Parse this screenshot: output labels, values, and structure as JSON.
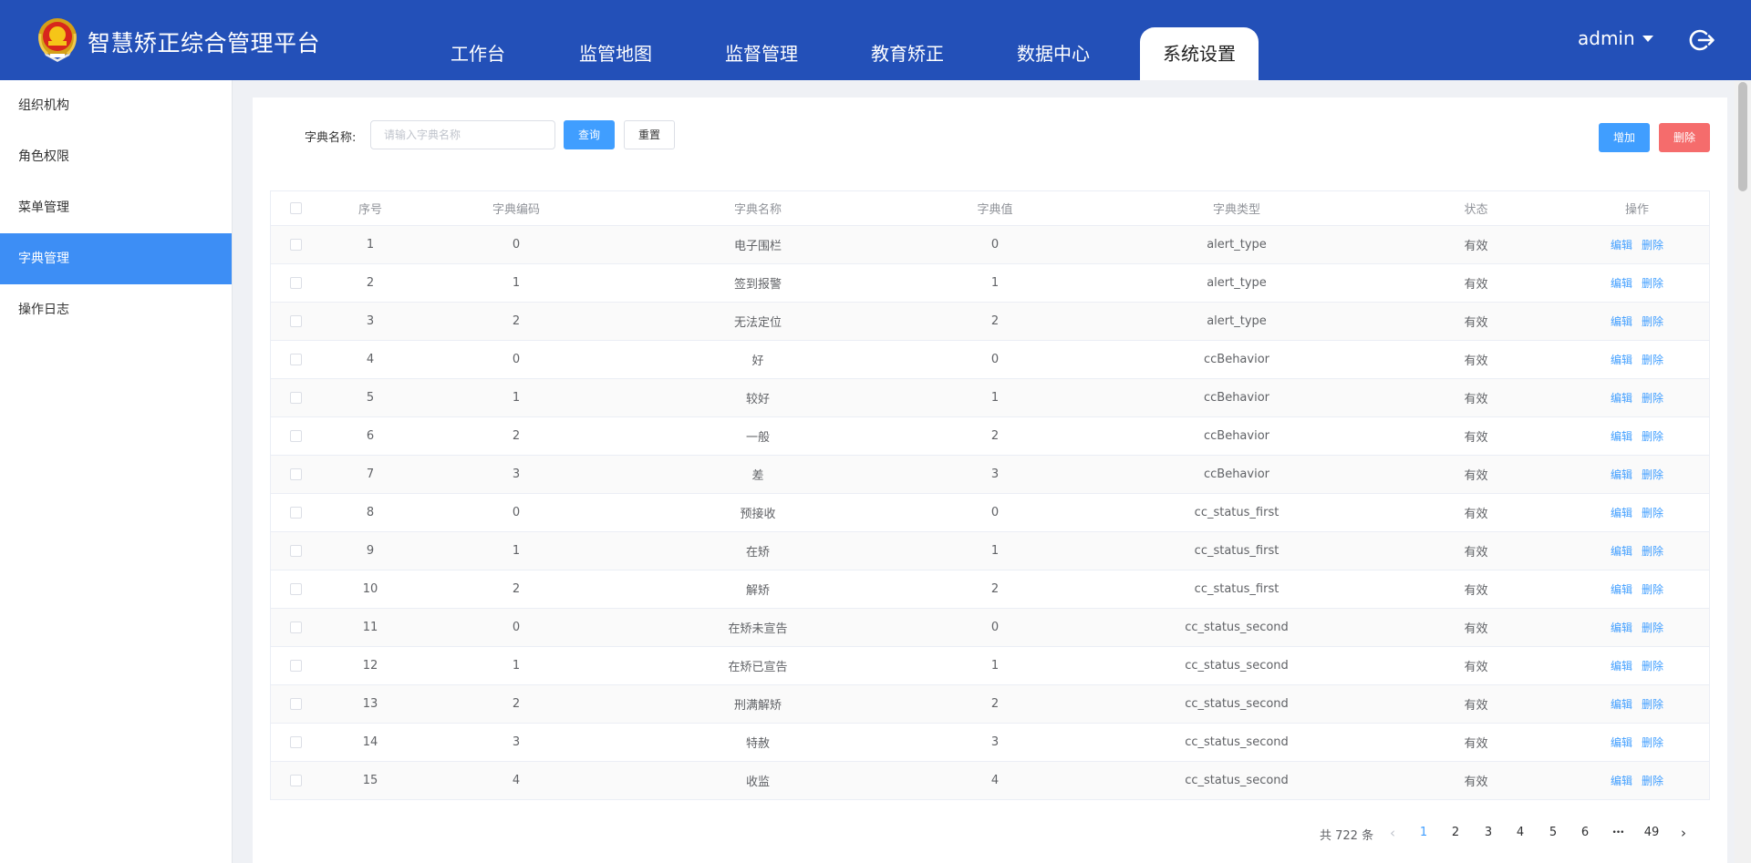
{
  "header": {
    "app_title": "智慧矫正综合管理平台",
    "nav_tabs": [
      {
        "label": "工作台"
      },
      {
        "label": "监管地图"
      },
      {
        "label": "监督管理"
      },
      {
        "label": "教育矫正"
      },
      {
        "label": "数据中心"
      },
      {
        "label": "系统设置",
        "active": true
      }
    ],
    "user_name": "admin",
    "brand_color": "#2350b8"
  },
  "sidebar": {
    "items": [
      {
        "label": "组织机构"
      },
      {
        "label": "角色权限"
      },
      {
        "label": "菜单管理"
      },
      {
        "label": "字典管理",
        "active": true
      },
      {
        "label": "操作日志"
      }
    ],
    "active_color": "#3d8ef5"
  },
  "search": {
    "label": "字典名称:",
    "value": "",
    "placeholder": "请输入字典名称",
    "query_label": "查询",
    "reset_label": "重置"
  },
  "toolbar": {
    "add_label": "增加",
    "delete_label": "删除"
  },
  "table": {
    "columns": [
      "序号",
      "字典编码",
      "字典名称",
      "字典值",
      "字典类型",
      "状态",
      "操作"
    ],
    "edit_label": "编辑",
    "delete_label": "删除",
    "rows": [
      {
        "index": "1",
        "code": "0",
        "name": "电子围栏",
        "value": "0",
        "type": "alert_type",
        "status": "有效"
      },
      {
        "index": "2",
        "code": "1",
        "name": "签到报警",
        "value": "1",
        "type": "alert_type",
        "status": "有效"
      },
      {
        "index": "3",
        "code": "2",
        "name": "无法定位",
        "value": "2",
        "type": "alert_type",
        "status": "有效"
      },
      {
        "index": "4",
        "code": "0",
        "name": "好",
        "value": "0",
        "type": "ccBehavior",
        "status": "有效"
      },
      {
        "index": "5",
        "code": "1",
        "name": "较好",
        "value": "1",
        "type": "ccBehavior",
        "status": "有效"
      },
      {
        "index": "6",
        "code": "2",
        "name": "一般",
        "value": "2",
        "type": "ccBehavior",
        "status": "有效"
      },
      {
        "index": "7",
        "code": "3",
        "name": "差",
        "value": "3",
        "type": "ccBehavior",
        "status": "有效"
      },
      {
        "index": "8",
        "code": "0",
        "name": "预接收",
        "value": "0",
        "type": "cc_status_first",
        "status": "有效"
      },
      {
        "index": "9",
        "code": "1",
        "name": "在矫",
        "value": "1",
        "type": "cc_status_first",
        "status": "有效"
      },
      {
        "index": "10",
        "code": "2",
        "name": "解矫",
        "value": "2",
        "type": "cc_status_first",
        "status": "有效"
      },
      {
        "index": "11",
        "code": "0",
        "name": "在矫未宣告",
        "value": "0",
        "type": "cc_status_second",
        "status": "有效"
      },
      {
        "index": "12",
        "code": "1",
        "name": "在矫已宣告",
        "value": "1",
        "type": "cc_status_second",
        "status": "有效"
      },
      {
        "index": "13",
        "code": "2",
        "name": "刑满解矫",
        "value": "2",
        "type": "cc_status_second",
        "status": "有效"
      },
      {
        "index": "14",
        "code": "3",
        "name": "特赦",
        "value": "3",
        "type": "cc_status_second",
        "status": "有效"
      },
      {
        "index": "15",
        "code": "4",
        "name": "收监",
        "value": "4",
        "type": "cc_status_second",
        "status": "有效"
      }
    ]
  },
  "pagination": {
    "total_text": "共 722 条",
    "pages": [
      "1",
      "2",
      "3",
      "4",
      "5",
      "6"
    ],
    "ellipsis": "•••",
    "last_page": "49",
    "current_page": "1"
  }
}
